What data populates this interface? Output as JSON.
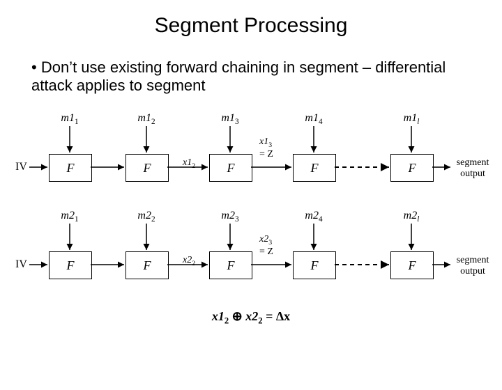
{
  "title": "Segment Processing",
  "bullet": "Don’t use existing forward chaining in segment – differential attack applies to segment",
  "row1": {
    "iv": "IV",
    "m": [
      "m1",
      "m1",
      "m1",
      "m1",
      "m1"
    ],
    "msub": [
      "1",
      "2",
      "3",
      "4",
      "l"
    ],
    "fbox": "F",
    "x_mid": "x1",
    "x_mid_sub": "2",
    "x_out_a": "x1",
    "x_out_a_sub": "3",
    "x_out_b": "= Z",
    "output_a": "segment",
    "output_b": "output"
  },
  "row2": {
    "iv": "IV",
    "m": [
      "m2",
      "m2",
      "m2",
      "m2",
      "m2"
    ],
    "msub": [
      "1",
      "2",
      "3",
      "4",
      "l"
    ],
    "fbox": "F",
    "x_mid": "x2",
    "x_mid_sub": "2",
    "x_out_a": "x2",
    "x_out_a_sub": "3",
    "x_out_b": "= Z",
    "output_a": "segment",
    "output_b": "output"
  },
  "equation": {
    "lhs_a": "x1",
    "lhs_a_sub": "2",
    "op": "⊕",
    "lhs_b": "x2",
    "lhs_b_sub": "2",
    "eq": "=",
    "rhs": "Δx"
  },
  "chart_data": {
    "type": "diagram",
    "description": "Two parallel Merkle-Damgård-style hash chains (segment processing) with IV feeding a row of F blocks. Message blocks m1_1..m1_l feed the first chain, m2_1..m2_l the second. Intermediate chaining values x1_2 and x2_2 are marked between the 2nd and 3rd F boxes; x1_3 and x2_3 equal Z after the 3rd box. Both chains produce 'segment output'. The XOR of x1_2 and x2_2 equals Δx.",
    "rows": 2,
    "blocks_per_row": 5,
    "labels_top_row1": [
      "m1_1",
      "m1_2",
      "m1_3",
      "m1_4",
      "m1_l"
    ],
    "labels_top_row2": [
      "m2_1",
      "m2_2",
      "m2_3",
      "m2_4",
      "m2_l"
    ],
    "chaining_annotations": {
      "after_box2": [
        "x1_2",
        "x2_2"
      ],
      "after_box3": [
        "x1_3 = Z",
        "x2_3 = Z"
      ]
    },
    "final_relation": "x1_2 ⊕ x2_2 = Δx"
  }
}
